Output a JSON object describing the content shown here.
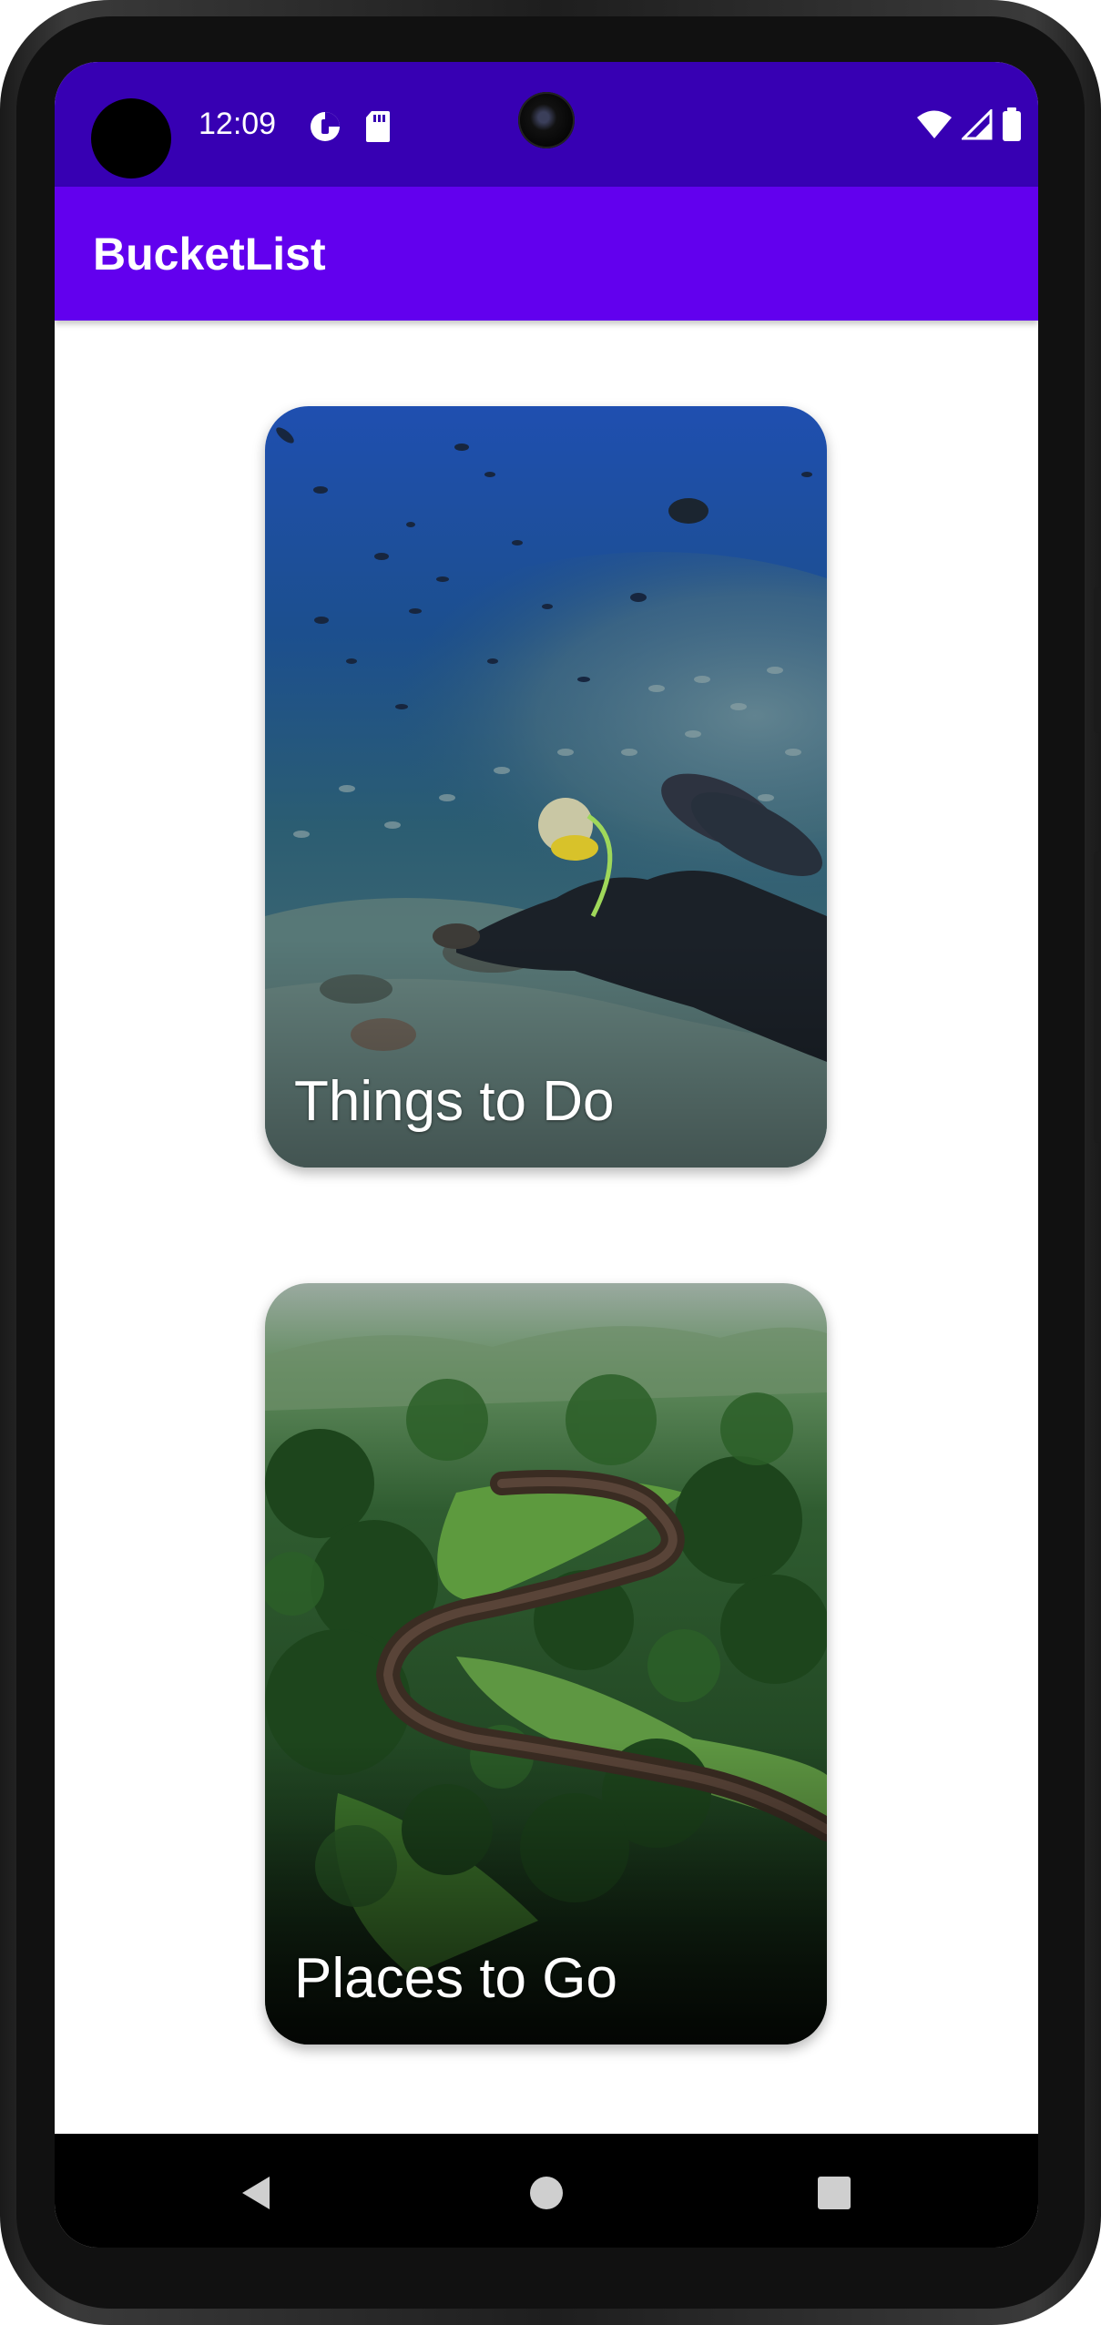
{
  "status_bar": {
    "time": "12:09",
    "background": "#3700b3",
    "left_icons": [
      "data-saver-icon",
      "sd-card-icon"
    ],
    "right_icons": [
      "wifi-icon",
      "cell-signal-icon",
      "battery-icon"
    ]
  },
  "app_bar": {
    "title": "BucketList",
    "background": "#6200ee"
  },
  "cards": [
    {
      "label": "Things to Do",
      "image": "scuba-diver-with-fish-photo"
    },
    {
      "label": "Places to Go",
      "image": "river-through-forest-aerial-photo"
    }
  ],
  "nav_bar": {
    "buttons": [
      "back-icon",
      "home-icon",
      "recents-icon"
    ]
  }
}
